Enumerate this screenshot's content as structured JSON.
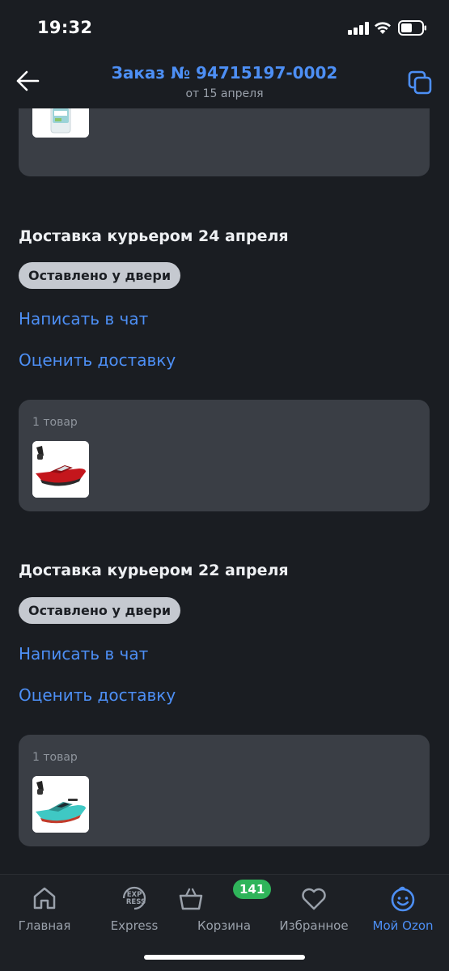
{
  "status_bar": {
    "time": "19:32"
  },
  "header": {
    "title": "Заказ № 94715197-0002",
    "subtitle": "от 15 апреля"
  },
  "deliveries": [
    {
      "title": "Доставка курьером 24 апреля",
      "status": "Оставлено у двери",
      "chat_link": "Написать в чат",
      "rate_link": "Оценить доставку",
      "items_count": "1 товар",
      "item_image": "red-rc-boat"
    },
    {
      "title": "Доставка курьером 22 апреля",
      "status": "Оставлено у двери",
      "chat_link": "Написать в чат",
      "rate_link": "Оценить доставку",
      "items_count": "1 товар",
      "item_image": "teal-rc-boat"
    }
  ],
  "top_card": {
    "item_image": "detergent-bottle"
  },
  "tabbar": {
    "tabs": [
      {
        "label": "Главная",
        "icon": "home-icon",
        "active": false
      },
      {
        "label": "Express",
        "icon": "express-icon",
        "icon_text": [
          "EXP",
          "RESS"
        ],
        "active": false
      },
      {
        "label": "Корзина",
        "icon": "cart-icon",
        "active": false
      },
      {
        "label": "Избранное",
        "icon": "heart-icon",
        "active": false
      },
      {
        "label": "Мой Ozon",
        "icon": "profile-smile-icon",
        "active": true
      }
    ],
    "cart_badge": "141"
  },
  "colors": {
    "accent": "#4d8ff5",
    "background": "#1a1d22",
    "card": "#3a3e45",
    "badge_green": "#2fb45a"
  }
}
